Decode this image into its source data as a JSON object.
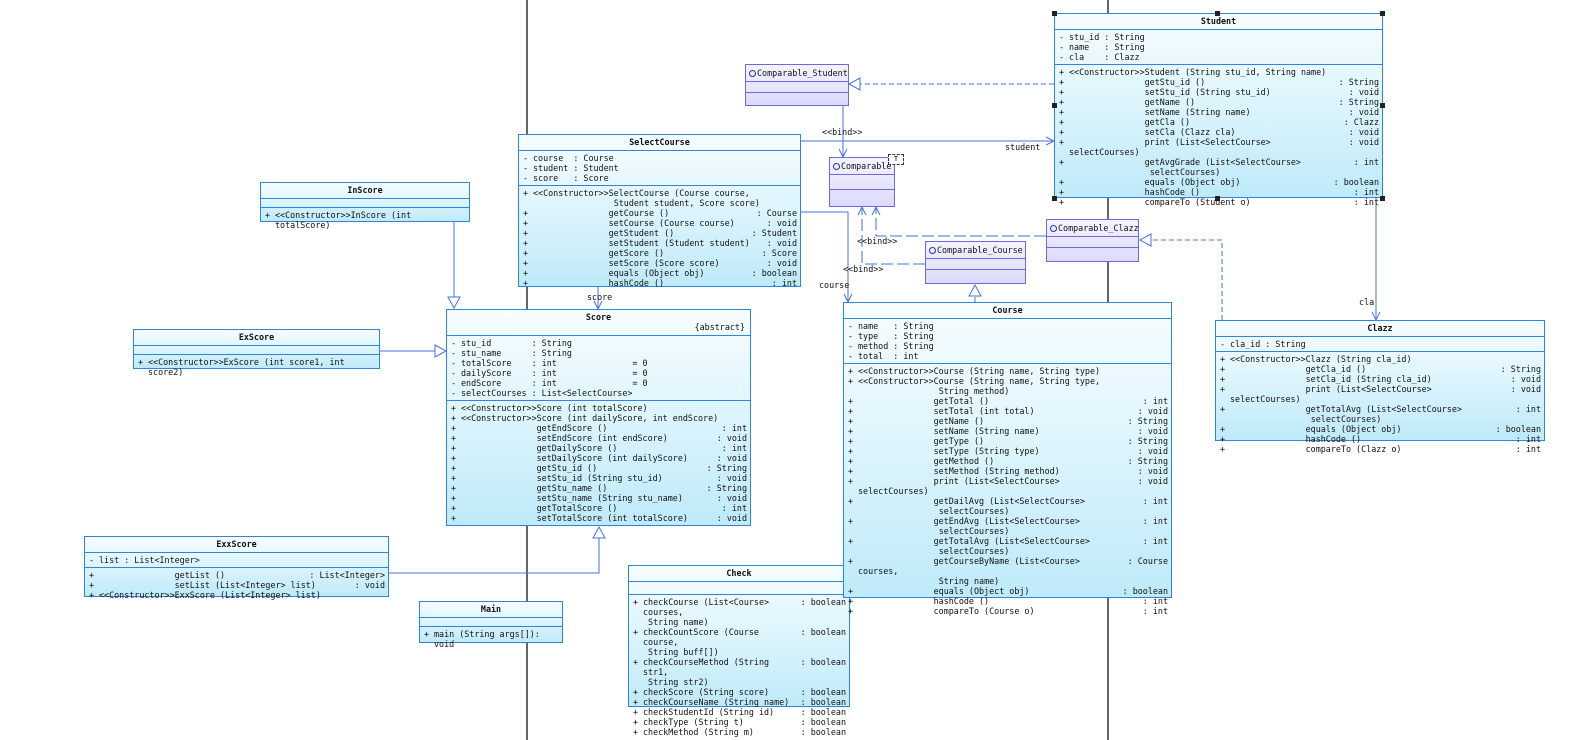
{
  "diagram": {
    "classes": {
      "student": {
        "name": "Student",
        "attributes": [
          {
            "v": "-",
            "s": "stu_id : String",
            "t": ""
          },
          {
            "v": "-",
            "s": "name   : String",
            "t": ""
          },
          {
            "v": "-",
            "s": "cla    : Clazz",
            "t": ""
          }
        ],
        "operations": [
          {
            "v": "+",
            "s": "<<Constructor>>Student (String stu_id, String name)",
            "t": ""
          },
          {
            "v": "+",
            "s": "               getStu_id ()",
            "t": ": String"
          },
          {
            "v": "+",
            "s": "               setStu_id (String stu_id)",
            "t": ": void"
          },
          {
            "v": "+",
            "s": "               getName ()",
            "t": ": String"
          },
          {
            "v": "+",
            "s": "               setName (String name)",
            "t": ": void"
          },
          {
            "v": "+",
            "s": "               getCla ()",
            "t": ": Clazz"
          },
          {
            "v": "+",
            "s": "               setCla (Clazz cla)",
            "t": ": void"
          },
          {
            "v": "+",
            "s": "               print (List<SelectCourse> selectCourses)",
            "t": ": void"
          },
          {
            "v": "+",
            "s": "               getAvgGrade (List<SelectCourse>\n                selectCourses)",
            "t": ": int"
          },
          {
            "v": "+",
            "s": "               equals (Object obj)",
            "t": ": boolean"
          },
          {
            "v": "+",
            "s": "               hashCode ()",
            "t": ": int"
          },
          {
            "v": "+",
            "s": "               compareTo (Student o)",
            "t": ": int"
          }
        ]
      },
      "selectcourse": {
        "name": "SelectCourse",
        "attributes": [
          {
            "v": "-",
            "s": "course  : Course",
            "t": ""
          },
          {
            "v": "-",
            "s": "student : Student",
            "t": ""
          },
          {
            "v": "-",
            "s": "score   : Score",
            "t": ""
          }
        ],
        "operations": [
          {
            "v": "+",
            "s": "<<Constructor>>SelectCourse (Course course,\n                Student student, Score score)",
            "t": ""
          },
          {
            "v": "+",
            "s": "               getCourse ()",
            "t": ": Course"
          },
          {
            "v": "+",
            "s": "               setCourse (Course course)",
            "t": ": void"
          },
          {
            "v": "+",
            "s": "               getStudent ()",
            "t": ": Student"
          },
          {
            "v": "+",
            "s": "               setStudent (Student student)",
            "t": ": void"
          },
          {
            "v": "+",
            "s": "               getScore ()",
            "t": ": Score"
          },
          {
            "v": "+",
            "s": "               setScore (Score score)",
            "t": ": void"
          },
          {
            "v": "+",
            "s": "               equals (Object obj)",
            "t": ": boolean"
          },
          {
            "v": "+",
            "s": "               hashCode ()",
            "t": ": int"
          }
        ]
      },
      "inscore": {
        "name": "InScore",
        "attributes": [],
        "operations": [
          {
            "v": "+",
            "s": "<<Constructor>>InScore (int totalScore)",
            "t": ""
          }
        ]
      },
      "exscore": {
        "name": "ExScore",
        "attributes": [],
        "operations": [
          {
            "v": "+",
            "s": "<<Constructor>>ExScore (int score1, int score2)",
            "t": ""
          }
        ]
      },
      "exxscore": {
        "name": "ExxScore",
        "attributes": [
          {
            "v": "-",
            "s": "list : List<Integer>",
            "t": ""
          }
        ],
        "operations": [
          {
            "v": "+",
            "s": "               getList ()",
            "t": ": List<Integer>"
          },
          {
            "v": "+",
            "s": "               setList (List<Integer> list)",
            "t": ": void"
          },
          {
            "v": "+",
            "s": "<<Constructor>>ExxScore (List<Integer> list)",
            "t": ""
          }
        ]
      },
      "main": {
        "name": "Main",
        "attributes": [],
        "operations": [
          {
            "v": "+",
            "s": "main (String args[]): void",
            "t": ""
          }
        ]
      },
      "score": {
        "name": "Score",
        "stereotype": "{abstract}",
        "attributes": [
          {
            "v": "-",
            "s": "stu_id        : String",
            "t": ""
          },
          {
            "v": "-",
            "s": "stu_name      : String",
            "t": ""
          },
          {
            "v": "-",
            "s": "totalScore    : int               = 0",
            "t": ""
          },
          {
            "v": "-",
            "s": "dailyScore    : int               = 0",
            "t": ""
          },
          {
            "v": "-",
            "s": "endScore      : int               = 0",
            "t": ""
          },
          {
            "v": "-",
            "s": "selectCourses : List<SelectCourse>",
            "t": ""
          }
        ],
        "operations": [
          {
            "v": "+",
            "s": "<<Constructor>>Score (int totalScore)",
            "t": ""
          },
          {
            "v": "+",
            "s": "<<Constructor>>Score (int dailyScore, int endScore)",
            "t": ""
          },
          {
            "v": "+",
            "s": "               getEndScore ()",
            "t": ": int"
          },
          {
            "v": "+",
            "s": "               setEndScore (int endScore)",
            "t": ": void"
          },
          {
            "v": "+",
            "s": "               getDailyScore ()",
            "t": ": int"
          },
          {
            "v": "+",
            "s": "               setDailyScore (int dailyScore)",
            "t": ": void"
          },
          {
            "v": "+",
            "s": "               getStu_id ()",
            "t": ": String"
          },
          {
            "v": "+",
            "s": "               setStu_id (String stu_id)",
            "t": ": void"
          },
          {
            "v": "+",
            "s": "               getStu_name ()",
            "t": ": String"
          },
          {
            "v": "+",
            "s": "               setStu_name (String stu_name)",
            "t": ": void"
          },
          {
            "v": "+",
            "s": "               getTotalScore ()",
            "t": ": int"
          },
          {
            "v": "+",
            "s": "               setTotalScore (int totalScore)",
            "t": ": void"
          }
        ]
      },
      "check": {
        "name": "Check",
        "attributes": [],
        "operations": [
          {
            "v": "+",
            "s": "checkCourse (List<Course> courses,\n String name)",
            "t": ": boolean"
          },
          {
            "v": "+",
            "s": "checkCountScore (Course course,\n String buff[])",
            "t": ": boolean"
          },
          {
            "v": "+",
            "s": "checkCourseMethod (String str1,\n String str2)",
            "t": ": boolean"
          },
          {
            "v": "+",
            "s": "checkScore (String score)",
            "t": ": boolean"
          },
          {
            "v": "+",
            "s": "checkCourseName (String name)",
            "t": ": boolean"
          },
          {
            "v": "+",
            "s": "checkStudentId (String id)",
            "t": ": boolean"
          },
          {
            "v": "+",
            "s": "checkType (String t)",
            "t": ": boolean"
          },
          {
            "v": "+",
            "s": "checkMethod (String m)",
            "t": ": boolean"
          }
        ]
      },
      "course": {
        "name": "Course",
        "attributes": [
          {
            "v": "-",
            "s": "name   : String",
            "t": ""
          },
          {
            "v": "-",
            "s": "type   : String",
            "t": ""
          },
          {
            "v": "-",
            "s": "method : String",
            "t": ""
          },
          {
            "v": "-",
            "s": "total  : int",
            "t": ""
          }
        ],
        "operations": [
          {
            "v": "+",
            "s": "<<Constructor>>Course (String name, String type)",
            "t": ""
          },
          {
            "v": "+",
            "s": "<<Constructor>>Course (String name, String type,\n                String method)",
            "t": ""
          },
          {
            "v": "+",
            "s": "               getTotal ()",
            "t": ": int"
          },
          {
            "v": "+",
            "s": "               setTotal (int total)",
            "t": ": void"
          },
          {
            "v": "+",
            "s": "               getName ()",
            "t": ": String"
          },
          {
            "v": "+",
            "s": "               setName (String name)",
            "t": ": void"
          },
          {
            "v": "+",
            "s": "               getType ()",
            "t": ": String"
          },
          {
            "v": "+",
            "s": "               setType (String type)",
            "t": ": void"
          },
          {
            "v": "+",
            "s": "               getMethod ()",
            "t": ": String"
          },
          {
            "v": "+",
            "s": "               setMethod (String method)",
            "t": ": void"
          },
          {
            "v": "+",
            "s": "               print (List<SelectCourse> selectCourses)",
            "t": ": void"
          },
          {
            "v": "+",
            "s": "               getDailAvg (List<SelectCourse>\n                selectCourses)",
            "t": ": int"
          },
          {
            "v": "+",
            "s": "               getEndAvg (List<SelectCourse>\n                selectCourses)",
            "t": ": int"
          },
          {
            "v": "+",
            "s": "               getTotalAvg (List<SelectCourse>\n                selectCourses)",
            "t": ": int"
          },
          {
            "v": "+",
            "s": "               getCourseByName (List<Course> courses,\n                String name)",
            "t": ": Course"
          },
          {
            "v": "+",
            "s": "               equals (Object obj)",
            "t": ": boolean"
          },
          {
            "v": "+",
            "s": "               hashCode ()",
            "t": ": int"
          },
          {
            "v": "+",
            "s": "               compareTo (Course o)",
            "t": ": int"
          }
        ]
      },
      "clazz": {
        "name": "Clazz",
        "attributes": [
          {
            "v": "-",
            "s": "cla_id : String",
            "t": ""
          }
        ],
        "operations": [
          {
            "v": "+",
            "s": "<<Constructor>>Clazz (String cla_id)",
            "t": ""
          },
          {
            "v": "+",
            "s": "               getCla_id ()",
            "t": ": String"
          },
          {
            "v": "+",
            "s": "               setCla_id (String cla_id)",
            "t": ": void"
          },
          {
            "v": "+",
            "s": "               print (List<SelectCourse> selectCourses)",
            "t": ": void"
          },
          {
            "v": "+",
            "s": "               getTotalAvg (List<SelectCourse>\n                selectCourses)",
            "t": ": int"
          },
          {
            "v": "+",
            "s": "               equals (Object obj)",
            "t": ": boolean"
          },
          {
            "v": "+",
            "s": "               hashCode ()",
            "t": ": int"
          },
          {
            "v": "+",
            "s": "               compareTo (Clazz o)",
            "t": ": int"
          }
        ]
      }
    },
    "interfaces": {
      "comparable_student": "Comparable_Student",
      "comparable": "Comparable",
      "comparable_course": "Comparable_Course",
      "comparable_clazz": "Comparable_Clazz"
    },
    "template_param": "T",
    "labels": {
      "bind_top": "<<bind>>",
      "bind_mid": "<<bind>>",
      "bind_low": "<<bind>>",
      "student_role": "student",
      "course_role": "course",
      "score_role": "score",
      "cla_role": "cla"
    },
    "colors": {
      "class_border": "#2e86d6",
      "interface_border": "#6c6cd8",
      "connector": "#5078e0"
    }
  }
}
